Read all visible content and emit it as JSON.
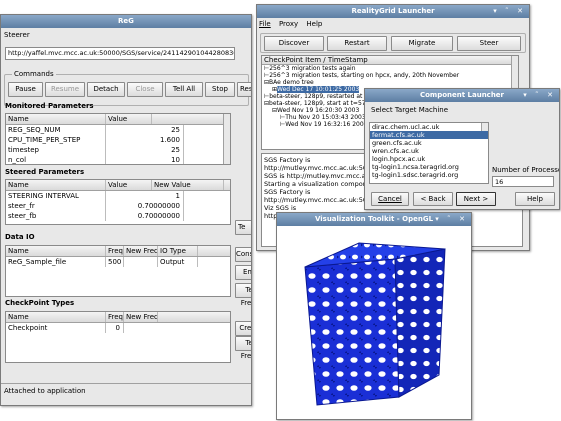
{
  "steerer": {
    "title": "ReG",
    "menu": "Steerer",
    "url": "http://yaffel.mvc.mcc.ac.uk:50000/SGS/service/24114290104428083682",
    "commands_label": "Commands",
    "buttons": {
      "pause": "Pause",
      "resume": "Resume",
      "detach": "Detach",
      "close": "Close",
      "tell_all": "Tell All",
      "stop": "Stop",
      "restart": "Resta"
    },
    "monitored": {
      "title": "Monitored Parameters",
      "columns": [
        "Name",
        "Value"
      ],
      "rows": [
        {
          "name": "REG_SEQ_NUM",
          "value": "25"
        },
        {
          "name": "CPU_TIME_PER_STEP",
          "value": "1.600"
        },
        {
          "name": "timestep",
          "value": "25"
        },
        {
          "name": "n_col",
          "value": "10"
        }
      ]
    },
    "steered": {
      "title": "Steered Parameters",
      "columns": [
        "Name",
        "Value",
        "New Value"
      ],
      "rows": [
        {
          "name": "STEERING INTERVAL",
          "value": "1"
        },
        {
          "name": "steer_fr",
          "value": "0.70000000"
        },
        {
          "name": "steer_fb",
          "value": "0.70000000"
        }
      ],
      "side_btn": "Te"
    },
    "dataio": {
      "title": "Data IO",
      "columns": [
        "Name",
        "Freq",
        "New Freq",
        "IO Type"
      ],
      "rows": [
        {
          "name": "ReG_Sample_file",
          "freq": "500",
          "io_type": "Output"
        }
      ],
      "buttons": {
        "consume": "Consume",
        "emit": "Emit",
        "tell_freqs": "Tell Freq's"
      }
    },
    "checkpoint": {
      "title": "CheckPoint Types",
      "columns": [
        "Name",
        "Freq",
        "New Freq"
      ],
      "rows": [
        {
          "name": "Checkpoint",
          "freq": "0"
        }
      ],
      "buttons": {
        "create": "Create",
        "tell_freqs": "Tell Freq's"
      }
    },
    "status": "Attached to application"
  },
  "launcher": {
    "title": "RealityGrid Launcher",
    "menu": [
      "File",
      "Proxy",
      "Help"
    ],
    "buttons": {
      "discover": "Discover",
      "restart": "Restart",
      "migrate": "Migrate",
      "steer": "Steer"
    },
    "tree_header": "CheckPoint Item / TimeStamp",
    "tree": [
      "256^3 migration tests again",
      "256^3 migration tests, starting on hpcx, andy, 20th November",
      "BAe demo tree",
      "Wed Dec 17 10:01:25 2003",
      "beta-steer, 128p9, restarted at 72",
      "beta-steer, 128p9, start at t=575(",
      "Wed Nov 19 16:20:30 2003",
      "Thu Nov 20 15:03:43 2003",
      "Wed Nov 19 16:32:16 2003"
    ],
    "log": [
      "SGS Factory is",
      "http://mutley.mvc.mcc.ac.uk:50000/",
      "SGS is http://mutley.mvc.mcc.ac.uk:",
      "Starting a visualization component",
      "SGS Factory is",
      "http://mutley.mvc.mcc.ac.uk:50000/",
      "Viz SGS is",
      "http"
    ]
  },
  "component": {
    "title": "Component Launcher",
    "prompt": "Select Target Machine",
    "machines": [
      "dirac.chem.ucl.ac.uk",
      "fermat.cfs.ac.uk",
      "green.cfs.ac.uk",
      "wren.cfs.ac.uk",
      "login.hpcx.ac.uk",
      "tg-login1.ncsa.teragrid.org",
      "tg-login1.sdsc.teragrid.org"
    ],
    "selected": "fermat.cfs.ac.uk",
    "procs_label": "Number of Processors",
    "procs_value": "16",
    "buttons": {
      "cancel": "Cancel",
      "back": "< Back",
      "next": "Next >",
      "help": "Help"
    }
  },
  "viz": {
    "title": "Visualization Toolkit - OpenGL"
  },
  "colors": {
    "title_bar": "#5d7ea3",
    "selection": "#3d6aa4",
    "render_bg": "#ffffff",
    "structure": "#1a2fd6"
  }
}
